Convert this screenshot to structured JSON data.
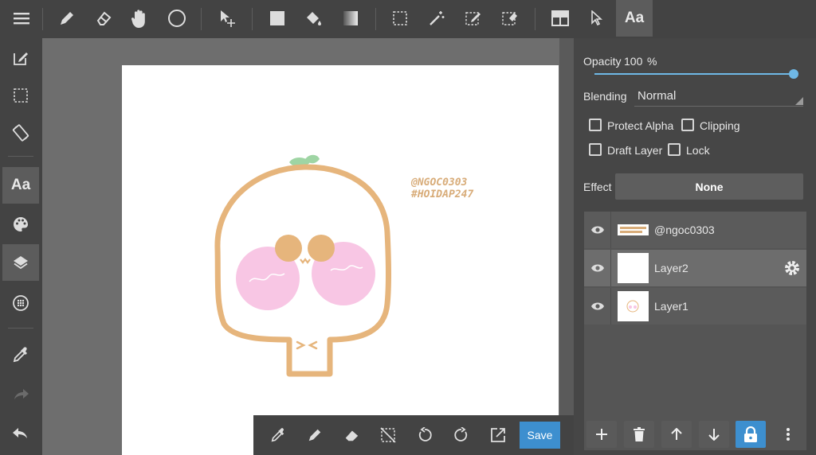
{
  "top_toolbar": {
    "font_tool_label": "Aa"
  },
  "sidebar": {
    "font_tool_label": "Aa"
  },
  "canvas": {
    "watermark_line1": "@NGOC0303",
    "watermark_line2": "#HOIDAP247"
  },
  "bottom_toolbar": {
    "save_label": "Save"
  },
  "layer_properties": {
    "opacity_label": "Opacity",
    "opacity_value": "100",
    "opacity_unit": "%",
    "opacity_level": 1.0,
    "blending_label": "Blending",
    "blending_value": "Normal",
    "protect_alpha_label": "Protect Alpha",
    "clipping_label": "Clipping",
    "draft_layer_label": "Draft Layer",
    "lock_label": "Lock",
    "effect_label": "Effect",
    "effect_value": "None"
  },
  "layers": [
    {
      "name": "@ngoc0303",
      "selected": false
    },
    {
      "name": "Layer2",
      "selected": true
    },
    {
      "name": "Layer1",
      "selected": false
    }
  ],
  "colors": {
    "accent": "#3d8fcf",
    "drawing_stroke": "#e6b57c",
    "blush": "#f8c6e4",
    "leaf": "#9fd5a4"
  }
}
